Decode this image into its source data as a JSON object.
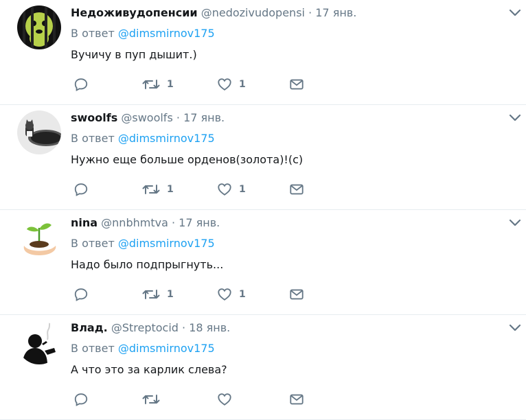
{
  "tweets": [
    {
      "name": "Недоживудопенсии",
      "handle": "@nedozivudopensi",
      "dot": "·",
      "time": "17 янв.",
      "reply_prefix": "В ответ",
      "reply_to": "@dimsmirnov175",
      "text": "Вучичу в пуп дышит.)",
      "retweets": "1",
      "likes": "1",
      "avatar_icon": "avatar-caged-animal"
    },
    {
      "name": "swoolfs",
      "handle": "@swoolfs",
      "dot": "·",
      "time": "17 янв.",
      "reply_prefix": "В ответ",
      "reply_to": "@dimsmirnov175",
      "text": "Нужно еще больше орденов(золота)!(с)",
      "retweets": "1",
      "likes": "1",
      "avatar_icon": "avatar-cat-photo"
    },
    {
      "name": "nina",
      "handle": "@nnbhmtva",
      "dot": "·",
      "time": "17 янв.",
      "reply_prefix": "В ответ",
      "reply_to": "@dimsmirnov175",
      "text": "Надо было подпрыгнуть...",
      "retweets": "1",
      "likes": "1",
      "avatar_icon": "avatar-sprout-in-hand"
    },
    {
      "name": "Влад.",
      "handle": "@Streptocid",
      "dot": "·",
      "time": "18 янв.",
      "reply_prefix": "В ответ",
      "reply_to": "@dimsmirnov175",
      "text": "А что это за карлик слева?",
      "retweets": "",
      "likes": "",
      "avatar_icon": "avatar-smoking-silhouette"
    }
  ],
  "colors": {
    "text": "#14171a",
    "muted": "#657786",
    "link": "#1da1f2",
    "divider": "#e6ecf0"
  },
  "icons": {
    "reply": "reply-icon",
    "retweet": "retweet-icon",
    "like": "heart-icon",
    "dm": "envelope-icon",
    "menu": "chevron-down-icon"
  }
}
